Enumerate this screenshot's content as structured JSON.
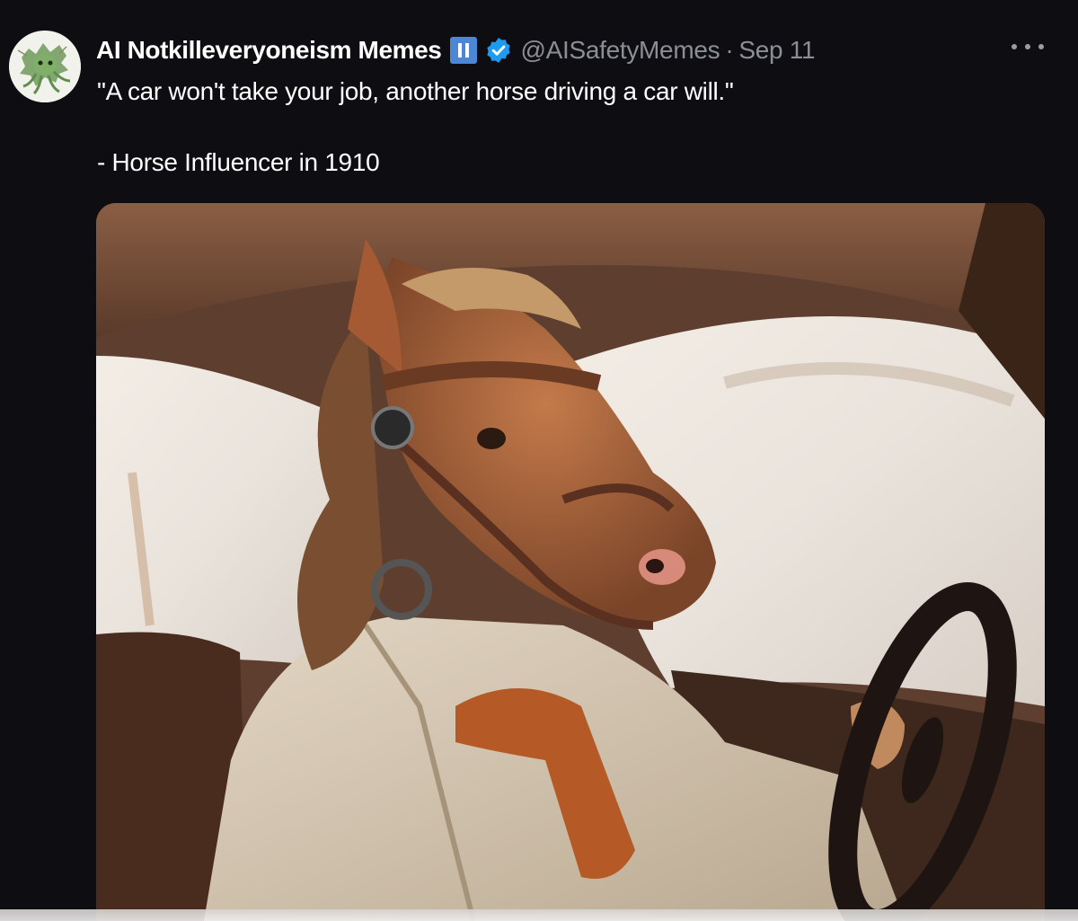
{
  "tweet": {
    "author": {
      "display_name": "AI Notkilleveryoneism Memes",
      "handle": "@AISafetyMemes",
      "avatar_icon": "octopus-avatar-icon",
      "badges": [
        "pause-badge-icon",
        "verified-badge-icon"
      ]
    },
    "separator": "·",
    "date": "Sep 11",
    "more_icon": "more-options-icon",
    "text_lines": [
      "\"A car won't take your job, another horse driving a car will.\"",
      "- Horse Influencer in 1910"
    ],
    "media": {
      "type": "image",
      "icon": "horse-driving-car-image"
    }
  },
  "colors": {
    "background": "#0d0d12",
    "text": "#ffffff",
    "secondary_text": "#8b8f95",
    "verified_blue": "#1d9bf0",
    "pause_badge": "#4e86d6"
  }
}
